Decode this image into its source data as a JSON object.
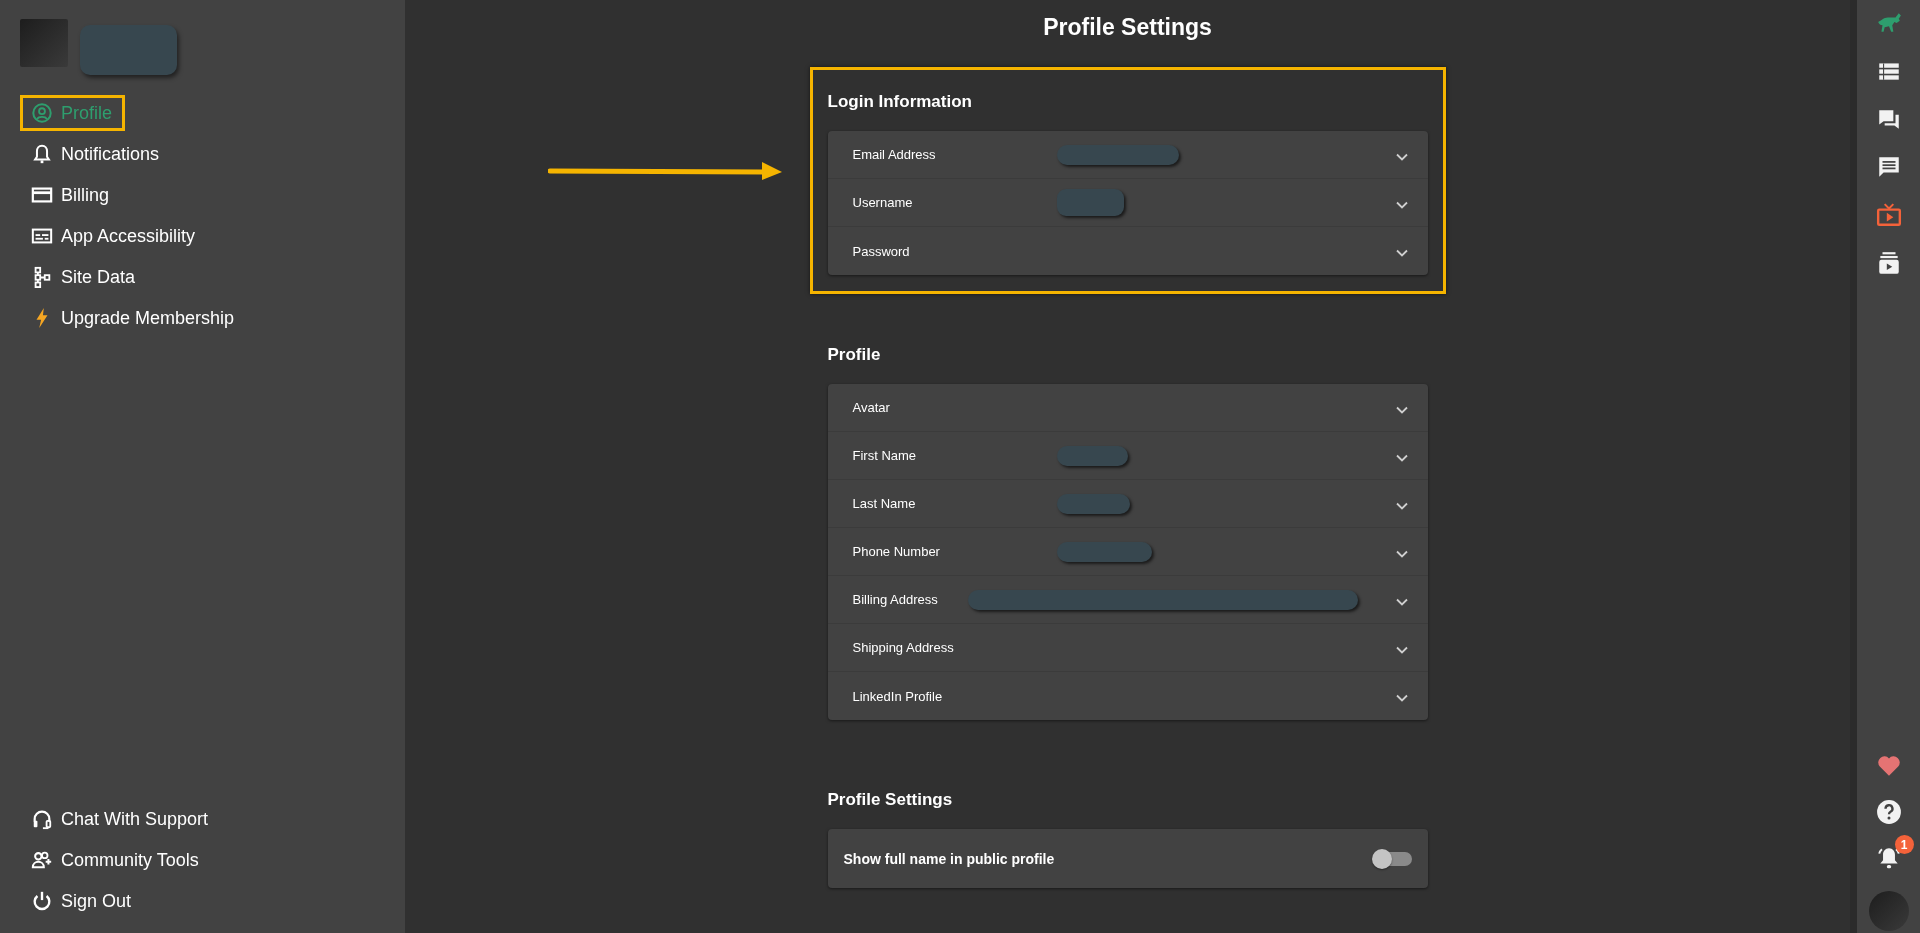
{
  "sidebar": {
    "user": {
      "name_redacted": true
    },
    "items": [
      {
        "label": "Profile",
        "selected": true,
        "highlighted": true
      },
      {
        "label": "Notifications",
        "selected": false,
        "highlighted": false
      },
      {
        "label": "Billing",
        "selected": false,
        "highlighted": false
      },
      {
        "label": "App Accessibility",
        "selected": false,
        "highlighted": false
      },
      {
        "label": "Site Data",
        "selected": false,
        "highlighted": false
      },
      {
        "label": "Upgrade Membership",
        "selected": false,
        "highlighted": false
      }
    ],
    "footer_items": [
      {
        "label": "Chat With Support"
      },
      {
        "label": "Community Tools"
      },
      {
        "label": "Sign Out"
      }
    ]
  },
  "page_title": "Profile Settings",
  "sections": [
    {
      "title": "Login Information",
      "highlighted": true,
      "kind": "accordion",
      "rows": [
        {
          "label": "Email Address",
          "redacted": true
        },
        {
          "label": "Username",
          "redacted": true
        },
        {
          "label": "Password",
          "redacted": false
        }
      ]
    },
    {
      "title": "Profile",
      "highlighted": false,
      "kind": "accordion",
      "rows": [
        {
          "label": "Avatar",
          "redacted": false
        },
        {
          "label": "First Name",
          "redacted": true
        },
        {
          "label": "Last Name",
          "redacted": true
        },
        {
          "label": "Phone Number",
          "redacted": true
        },
        {
          "label": "Billing Address",
          "redacted": true
        },
        {
          "label": "Shipping Address",
          "redacted": false
        },
        {
          "label": "LinkedIn Profile",
          "redacted": false
        }
      ]
    },
    {
      "title": "Profile Settings",
      "highlighted": false,
      "kind": "toggles",
      "rows": [
        {
          "label": "Show full name in public profile",
          "on": false
        }
      ]
    }
  ],
  "right_bar": {
    "notifications": {
      "badge": "1"
    }
  }
}
